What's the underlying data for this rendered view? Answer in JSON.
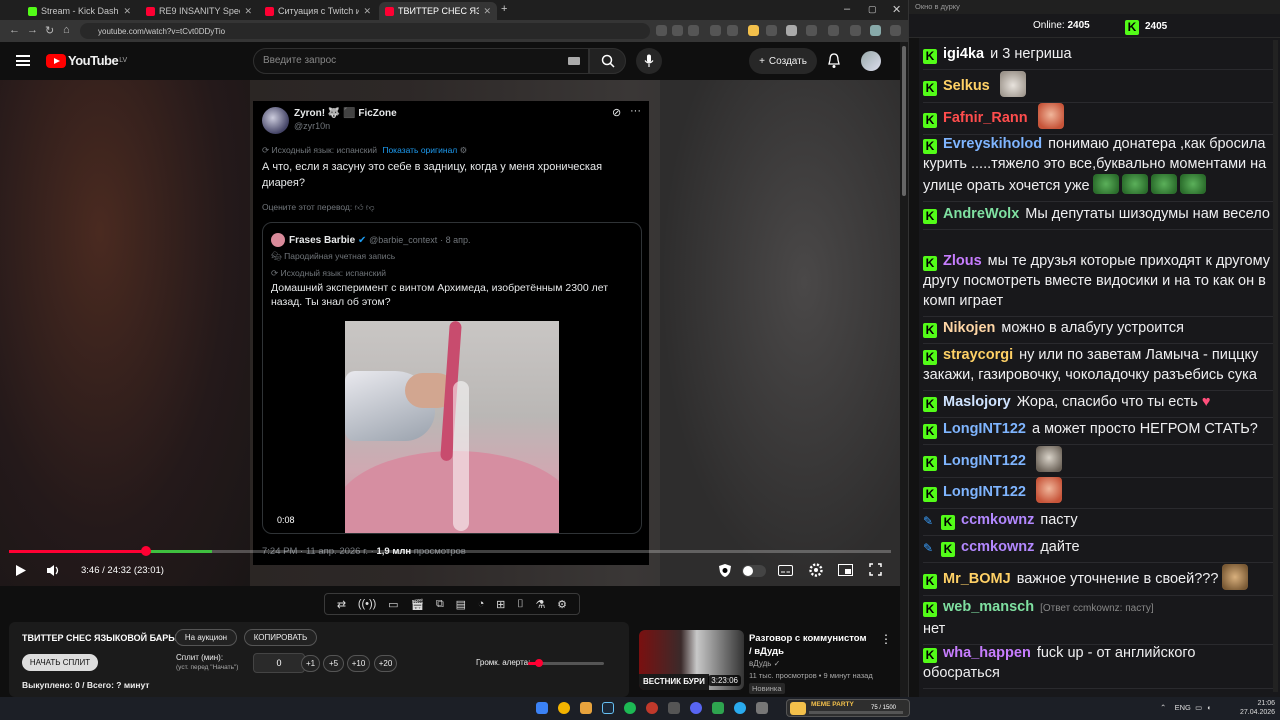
{
  "browser": {
    "tabs": [
      {
        "title": "Stream - Kick Dashboard",
        "color": "#53fc18"
      },
      {
        "title": "RE9 INSANITY Speedrun in 1:3",
        "color": "#ff0033"
      },
      {
        "title": "Ситуация с Twitch и Алабугой",
        "color": "#ff0033"
      },
      {
        "title": "ТВИТТЕР СНЕС ЯЗЫКОВОЙ БА",
        "color": "#ff0033",
        "active": true
      }
    ],
    "url": "youtube.com/watch?v=tCvt0DDyTio"
  },
  "youtube": {
    "logo_text": "YouTube",
    "logo_region": "LV",
    "search_placeholder": "Введите запрос",
    "create_label": "Создать"
  },
  "tweet": {
    "author_name": "Zyron! 🐺 ⬛ FicZone",
    "author_handle": "@zyr10n",
    "translate_line": "Исходный язык: испанский",
    "show_original": "Показать оригинал",
    "text": "А что, если я засуну это себе в задницу, когда у меня хроническая диарея?",
    "rate_translation": "Оцените этот перевод:",
    "quote": {
      "author_name": "Frases Barbie",
      "author_handle": "@barbie_context",
      "date": "· 8 апр.",
      "parody": "Пародийная учетная запись",
      "translate_line": "Исходный язык: испанский",
      "text": "Домашний эксперимент с винтом Архимеда, изобретённым 2300 лет назад. Ты знал об этом?",
      "video_time": "0:08"
    },
    "footer_time": "7:24 PM · 11 апр. 2026 г. ·",
    "footer_views": "1,9 млн",
    "footer_views_label": "просмотров"
  },
  "player": {
    "time": "3:46 / 24:32 (23:01)",
    "progress_played": 0.155,
    "progress_green_start": 0.155,
    "progress_green_end": 0.23
  },
  "stream_panel": {
    "title": "ТВИТТЕР СНЕС ЯЗЫКОВОЙ БАРЬЕР",
    "auction_btn": "На аукцион",
    "copy_btn": "КОПИРОВАТЬ",
    "start_split_btn": "НАЧАТЬ СПЛИТ",
    "split_label": "Сплит (мин):",
    "split_hint": "(уст. перед \"Начать\")",
    "split_value": "0",
    "increments": [
      "+1",
      "+5",
      "+10",
      "+20"
    ],
    "alert_volume_label": "Громк. алерта:",
    "alert_volume": 0.15,
    "bought": "Выкуплено: 0 / Всего: ? минут"
  },
  "recommendation": {
    "title": "Разговор с коммунистом / вДудь",
    "channel": "вДудь",
    "meta": "11 тыс. просмотров • 9 минут назад",
    "badge": "Новинка",
    "thumb_caption": "ВЕСТНИК БУРИ",
    "duration": "3:23:06"
  },
  "chat": {
    "window_title": "Окно в дурку",
    "online_label": "Online:",
    "online_count": "2405",
    "viewers_count": "2405",
    "messages": [
      {
        "user": "igi4ka",
        "color": "#ffffff",
        "text": "и 3 негриша"
      },
      {
        "user": "Selkus",
        "color": "#ffd166",
        "text": "",
        "emote": "cat"
      },
      {
        "user": "Fafnir_Rann",
        "color": "#ff4d4d",
        "text": "",
        "emote": "face"
      },
      {
        "user": "Evreyskiholod",
        "color": "#7fb5ff",
        "text": "понимаю донатера ,как бросила курить .....тяжело это все,буквально моментами на улице орать хочется уже"
      },
      {
        "user": "AndreWolx",
        "color": "#7fe0a1",
        "text": "Мы депутаты шизодумы нам весело"
      },
      {
        "user": "Zlous",
        "color": "#c77dff",
        "text": "мы те друзья которые приходят к другому другу посмотреть вместе видосики и на то как он в комп играет"
      },
      {
        "user": "Nikojen",
        "color": "#ffd6a5",
        "text": "можно в алабугу устроится"
      },
      {
        "user": "straycorgi",
        "color": "#ffd166",
        "text": "ну или по заветам Ламыча - пиццку закажи, газировочку, чоколадочку разъебись сука"
      },
      {
        "user": "Maslojory",
        "color": "#cfe3ff",
        "text": "Жора, спасибо что ты есть"
      },
      {
        "user": "LongINT122",
        "color": "#7fb5ff",
        "text": "а может просто НЕГРОМ СТАТЬ?"
      },
      {
        "user": "LongINT122",
        "color": "#7fb5ff",
        "text": "",
        "emote": "gray"
      },
      {
        "user": "LongINT122",
        "color": "#7fb5ff",
        "text": "",
        "emote": "face"
      },
      {
        "user": "ccmkownz",
        "color": "#b388ff",
        "text": "пасту"
      },
      {
        "user": "ccmkownz",
        "color": "#b388ff",
        "text": "дайте"
      },
      {
        "user": "Mr_BOMJ",
        "color": "#ffd166",
        "text": "важное уточнение в своей???"
      },
      {
        "user": "web_mansch",
        "color": "#7fe0a1",
        "reply": "[Ответ ccmkownz: пасту]",
        "text": "нет"
      },
      {
        "user": "wha_happen",
        "color": "#c77dff",
        "text": "fuck up - от английского обосраться"
      }
    ]
  },
  "taskbar": {
    "widget_label": "MEME PARTY",
    "widget_count": "75 / 1500",
    "lang": "ENG",
    "time": "21:06",
    "date": "27.04.2026"
  }
}
